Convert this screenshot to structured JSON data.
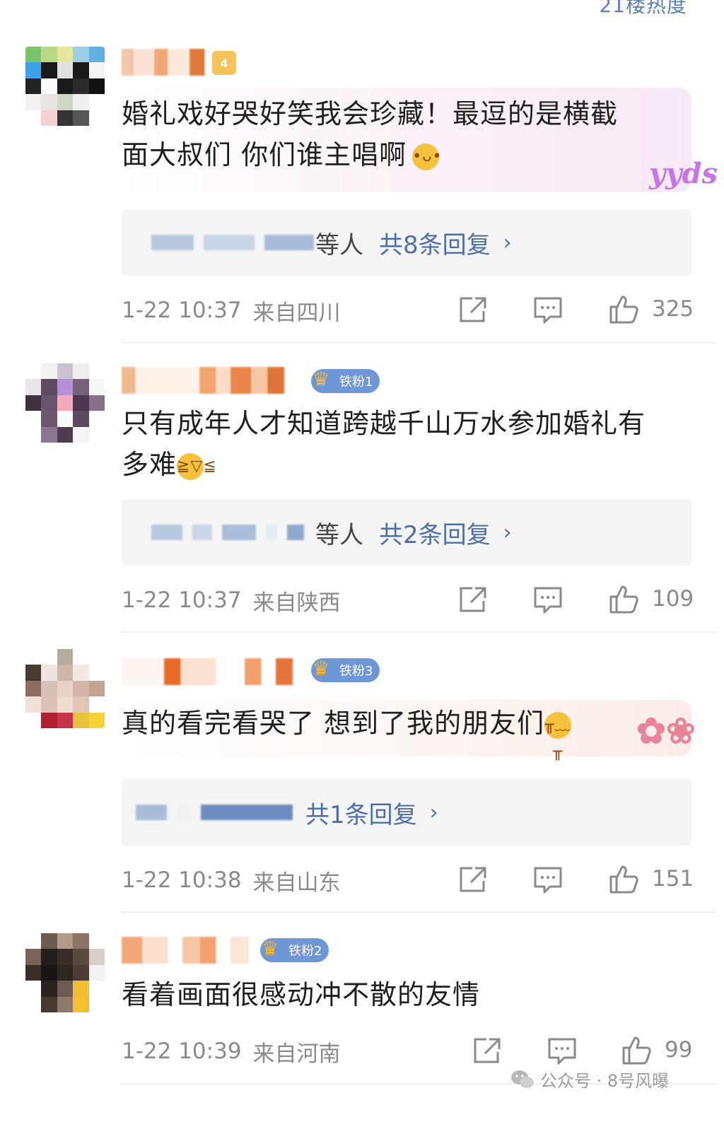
{
  "top_hint": "21楼热度",
  "comments": [
    {
      "text_line1": "婚礼戏好哭好笑我会珍藏！最逗的是横截",
      "text_line2": "面大叔们 你们谁主唱啊",
      "sticker": "yyds",
      "reply_people": "等人",
      "reply_link": "共8条回复",
      "time": "1-22 10:37",
      "location": "来自四川",
      "likes": "325",
      "badge_level": "4"
    },
    {
      "text_line1": "只有成年人才知道跨越千山万水参加婚礼有",
      "text_line2": "多难",
      "fan_badge": "铁粉1",
      "reply_people": "等人",
      "reply_link": "共2条回复",
      "time": "1-22 10:37",
      "location": "来自陕西",
      "likes": "109"
    },
    {
      "text_line1": "真的看完看哭了 想到了我的朋友们",
      "fan_badge": "铁粉3",
      "reply_link": "共1条回复",
      "time": "1-22 10:38",
      "location": "来自山东",
      "likes": "151"
    },
    {
      "text_line1": "看着画面很感动冲不散的友情",
      "fan_badge": "铁粉2",
      "time": "1-22 10:39",
      "location": "来自河南",
      "likes": "99"
    }
  ],
  "watermark": "公众号 · 8号风曝",
  "icons": {
    "share": "share-icon",
    "comment": "comment-icon",
    "like": "thumbs-up-icon"
  },
  "colors": {
    "link": "#4d6fa9",
    "meta": "#8a8a8a",
    "fan_badge": "#6f97d6",
    "reply_bg": "#f5f5f5"
  }
}
